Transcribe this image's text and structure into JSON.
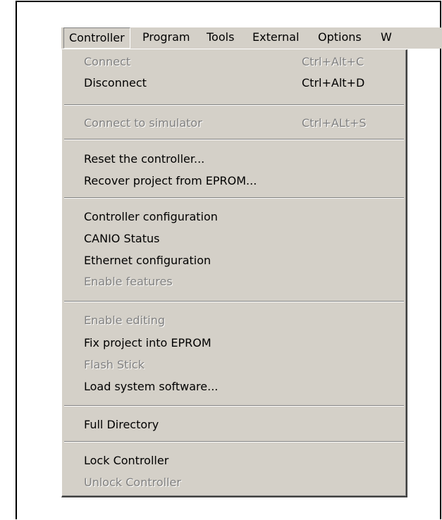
{
  "menubar": {
    "items": [
      {
        "label": "Controller"
      },
      {
        "label": "Program"
      },
      {
        "label": "Tools"
      },
      {
        "label": "External"
      },
      {
        "label": "Options"
      },
      {
        "label": "W"
      }
    ]
  },
  "menu": {
    "items": [
      {
        "label": "Connect",
        "shortcut": "Ctrl+Alt+C",
        "enabled": false
      },
      {
        "label": "Disconnect",
        "shortcut": "Ctrl+Alt+D",
        "enabled": true
      },
      {
        "label": "Connect to simulator",
        "shortcut": "Ctrl+ALt+S",
        "enabled": false
      },
      {
        "label": "Reset the controller...",
        "enabled": true
      },
      {
        "label": "Recover project from EPROM...",
        "enabled": true
      },
      {
        "label": "Controller configuration",
        "enabled": true
      },
      {
        "label": "CANIO Status",
        "enabled": true
      },
      {
        "label": "Ethernet configuration",
        "enabled": true
      },
      {
        "label": "Enable features",
        "enabled": false
      },
      {
        "label": "Enable editing",
        "enabled": false
      },
      {
        "label": "Fix project into EPROM",
        "enabled": true
      },
      {
        "label": "Flash Stick",
        "enabled": false
      },
      {
        "label": "Load system software...",
        "enabled": true
      },
      {
        "label": "Full Directory",
        "enabled": true
      },
      {
        "label": "Lock Controller",
        "enabled": true
      },
      {
        "label": "Unlock Controller",
        "enabled": false
      }
    ]
  }
}
